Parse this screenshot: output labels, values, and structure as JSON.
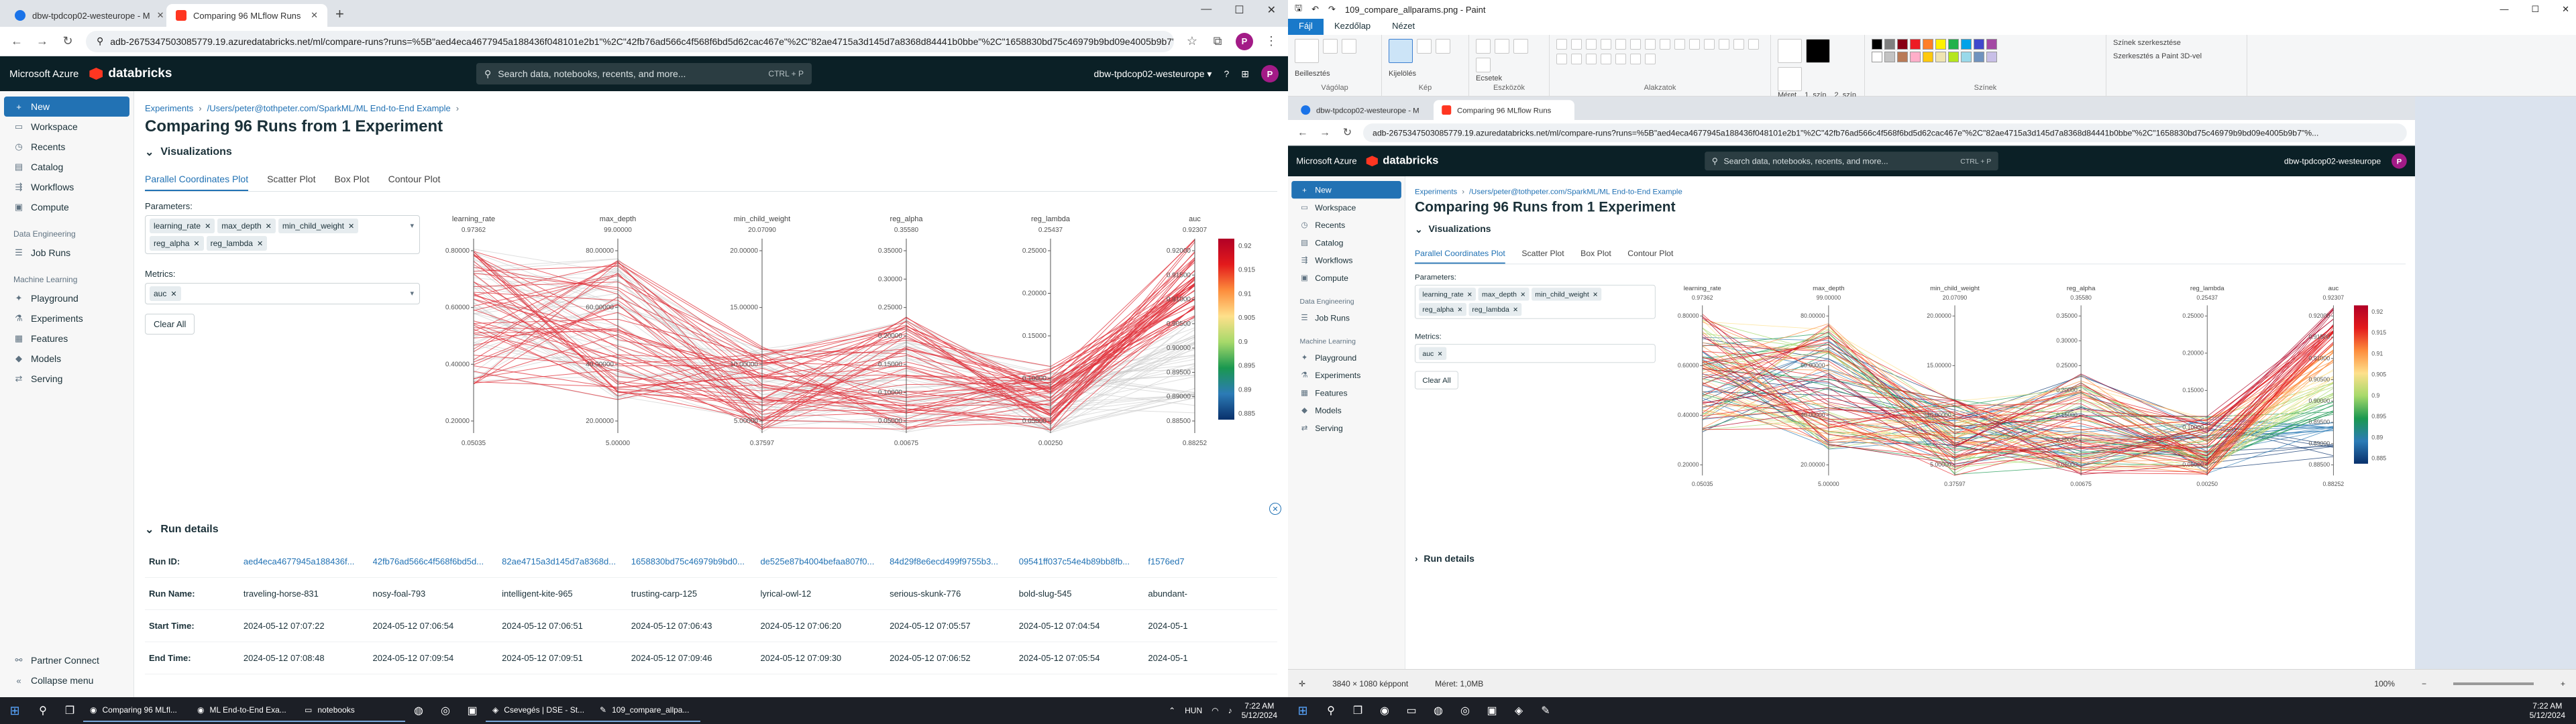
{
  "browser": {
    "tabs": [
      {
        "title": "dbw-tpdcop02-westeurope - M"
      },
      {
        "title": "Comparing 96 MLflow Runs"
      }
    ],
    "url": "adb-2675347503085779.19.azuredatabricks.net/ml/compare-runs?runs=%5B\"aed4eca4677945a188436f048101e2b1\"%2C\"42fb76ad566c4f568f6bd5d62cac467e\"%2C\"82ae4715a3d145d7a8368d84441b0bbe\"%2C\"1658830bd75c46979b9bd09e4005b9b7\"%...",
    "avatar": "P"
  },
  "databricks": {
    "ms_brand": "Microsoft Azure",
    "brand": "databricks",
    "search_placeholder": "Search data, notebooks, recents, and more...",
    "search_shortcut": "CTRL + P",
    "workspace": "dbw-tpdcop02-westeurope",
    "avatar": "P"
  },
  "sidebar": {
    "top": [
      {
        "label": "New",
        "icon": "plus-icon"
      },
      {
        "label": "Workspace",
        "icon": "folder-icon"
      },
      {
        "label": "Recents",
        "icon": "clock-icon"
      },
      {
        "label": "Catalog",
        "icon": "catalog-icon"
      },
      {
        "label": "Workflows",
        "icon": "workflows-icon"
      },
      {
        "label": "Compute",
        "icon": "compute-icon"
      }
    ],
    "data_engineering_title": "Data Engineering",
    "data_engineering": [
      {
        "label": "Job Runs",
        "icon": "jobs-icon"
      }
    ],
    "ml_title": "Machine Learning",
    "ml": [
      {
        "label": "Playground",
        "icon": "playground-icon"
      },
      {
        "label": "Experiments",
        "icon": "experiments-icon"
      },
      {
        "label": "Features",
        "icon": "features-icon"
      },
      {
        "label": "Models",
        "icon": "models-icon"
      },
      {
        "label": "Serving",
        "icon": "serving-icon"
      }
    ],
    "partner_connect": "Partner Connect",
    "collapse": "Collapse menu"
  },
  "page": {
    "breadcrumb": [
      "Experiments",
      "/Users/peter@tothpeter.com/SparkML/ML End-to-End Example"
    ],
    "title": "Comparing 96 Runs from 1 Experiment",
    "visualizations_title": "Visualizations",
    "viz_tabs": [
      "Parallel Coordinates Plot",
      "Scatter Plot",
      "Box Plot",
      "Contour Plot"
    ],
    "parameters_label": "Parameters:",
    "parameters": [
      "learning_rate",
      "max_depth",
      "min_child_weight",
      "reg_alpha",
      "reg_lambda"
    ],
    "metrics_label": "Metrics:",
    "metrics": [
      "auc"
    ],
    "clear_all": "Clear All",
    "run_details_title": "Run details"
  },
  "chart_data": {
    "type": "parallel_coordinates",
    "axes": [
      {
        "name": "learning_rate",
        "max": "0.97362",
        "min": "0.05035",
        "ticks": [
          "0.80000",
          "0.60000",
          "0.40000",
          "0.20000"
        ]
      },
      {
        "name": "max_depth",
        "max": "99.00000",
        "min": "5.00000",
        "ticks": [
          "80.00000",
          "60.00000",
          "40.00000",
          "20.00000"
        ]
      },
      {
        "name": "min_child_weight",
        "max": "20.07090",
        "min": "0.37597",
        "ticks": [
          "20.00000",
          "15.00000",
          "10.00000",
          "5.00000"
        ]
      },
      {
        "name": "reg_alpha",
        "max": "0.35580",
        "min": "0.00675",
        "ticks": [
          "0.35000",
          "0.30000",
          "0.25000",
          "0.20000",
          "0.15000",
          "0.10000",
          "0.05000"
        ]
      },
      {
        "name": "reg_lambda",
        "max": "0.25437",
        "min": "0.00250",
        "ticks": [
          "0.25000",
          "0.20000",
          "0.15000",
          "0.10000",
          "0.05000"
        ]
      },
      {
        "name": "auc",
        "max": "0.92307",
        "min": "0.88252",
        "ticks": [
          "0.92000",
          "0.91500",
          "0.91000",
          "0.90500",
          "0.90000",
          "0.89500",
          "0.89000",
          "0.88500"
        ]
      }
    ],
    "colorbar": {
      "ticks": [
        "0.92",
        "0.915",
        "0.91",
        "0.905",
        "0.9",
        "0.895",
        "0.89",
        "0.885"
      ],
      "colors": [
        "#b10026",
        "#e31a1c",
        "#fd8d3c",
        "#fee08b",
        "#a6d96a",
        "#1a9850",
        "#2c7bb6",
        "#08306b"
      ]
    },
    "left_highlight_color": "#e0303a",
    "left_muted_color": "#c8c8c8"
  },
  "run_details": {
    "rows": [
      {
        "key": "Run ID:",
        "values": [
          "aed4eca4677945a188436f...",
          "42fb76ad566c4f568f6bd5d...",
          "82ae4715a3d145d7a8368d...",
          "1658830bd75c46979b9bd0...",
          "de525e87b4004befaa807f0...",
          "84d29f8e6ecd499f9755b3...",
          "09541ff037c54e4b89bb8fb...",
          "f1576ed7"
        ],
        "link": true
      },
      {
        "key": "Run Name:",
        "values": [
          "traveling-horse-831",
          "nosy-foal-793",
          "intelligent-kite-965",
          "trusting-carp-125",
          "lyrical-owl-12",
          "serious-skunk-776",
          "bold-slug-545",
          "abundant-"
        ],
        "link": false
      },
      {
        "key": "Start Time:",
        "values": [
          "2024-05-12 07:07:22",
          "2024-05-12 07:06:54",
          "2024-05-12 07:06:51",
          "2024-05-12 07:06:43",
          "2024-05-12 07:06:20",
          "2024-05-12 07:05:57",
          "2024-05-12 07:04:54",
          "2024-05-1"
        ],
        "link": false
      },
      {
        "key": "End Time:",
        "values": [
          "2024-05-12 07:08:48",
          "2024-05-12 07:09:54",
          "2024-05-12 07:09:51",
          "2024-05-12 07:09:46",
          "2024-05-12 07:09:30",
          "2024-05-12 07:06:52",
          "2024-05-12 07:05:54",
          "2024-05-1"
        ],
        "link": false
      }
    ]
  },
  "paint": {
    "title": "109_compare_allparams.png - Paint",
    "menu": [
      "Fájl",
      "Kezdőlap",
      "Nézet"
    ],
    "groups": [
      "Vágólap",
      "Kép",
      "Eszközök",
      "Alakzatok",
      "Színek"
    ],
    "clipboard": "Beillesztés",
    "select": "Kijelölés",
    "brushes": "Ecsetek",
    "size": "Méret",
    "color1": "1. szín",
    "color2": "2. szín",
    "edit_colors": "Színek szerkesztése",
    "paint3d": "Szerkesztés a Paint 3D-vel",
    "status_dimensions": "3840 × 1080 képpont",
    "status_size": "Méret: 1,0MB",
    "zoom": "100%",
    "swatches": [
      "#000000",
      "#7f7f7f",
      "#880015",
      "#ed1c24",
      "#ff7f27",
      "#fff200",
      "#22b14c",
      "#00a2e8",
      "#3f48cc",
      "#a349a4",
      "#ffffff",
      "#c3c3c3",
      "#b97a57",
      "#ffaec9",
      "#ffc90e",
      "#efe4b0",
      "#b5e61d",
      "#99d9ea",
      "#7092be",
      "#c8bfe7"
    ]
  },
  "taskbar_left": {
    "apps": [
      "Comparing 96 MLfl...",
      "ML End-to-End Exa...",
      "notebooks"
    ],
    "extra": [
      "Csevegés | DSE - St...",
      "109_compare_allpa..."
    ],
    "lang": "HUN",
    "time": "7:22 AM",
    "date": "5/12/2024"
  },
  "taskbar_right": {
    "time": "7:22 AM",
    "date": "5/12/2024"
  }
}
